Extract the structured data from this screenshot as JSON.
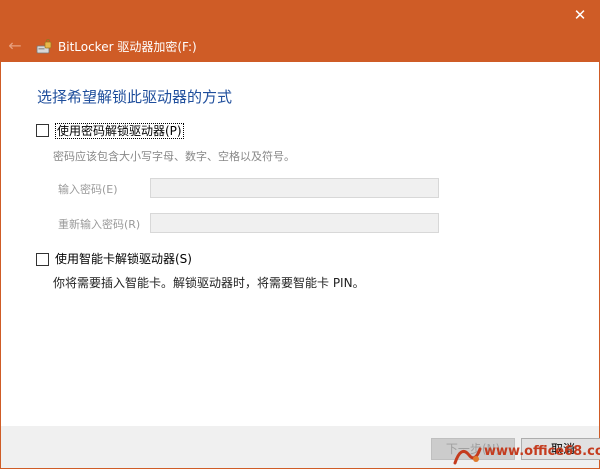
{
  "window": {
    "title": "BitLocker 驱动器加密(F:)"
  },
  "content": {
    "heading": "选择希望解锁此驱动器的方式",
    "password_option": {
      "label": "使用密码解锁驱动器(P)",
      "hint": "密码应该包含大小写字母、数字、空格以及符号。",
      "enter_label": "输入密码(E)",
      "reenter_label": "重新输入密码(R)",
      "enter_value": "",
      "reenter_value": ""
    },
    "smartcard_option": {
      "label": "使用智能卡解锁驱动器(S)",
      "description": "你将需要插入智能卡。解锁驱动器时，将需要智能卡 PIN。"
    }
  },
  "footer": {
    "next_label": "下一步(N)",
    "cancel_label": "取消"
  },
  "watermark": {
    "text": "www.office68.com"
  },
  "colors": {
    "accent": "#cf5c26",
    "heading": "#1f4e9c",
    "footer_bg": "#f0f0f0"
  }
}
